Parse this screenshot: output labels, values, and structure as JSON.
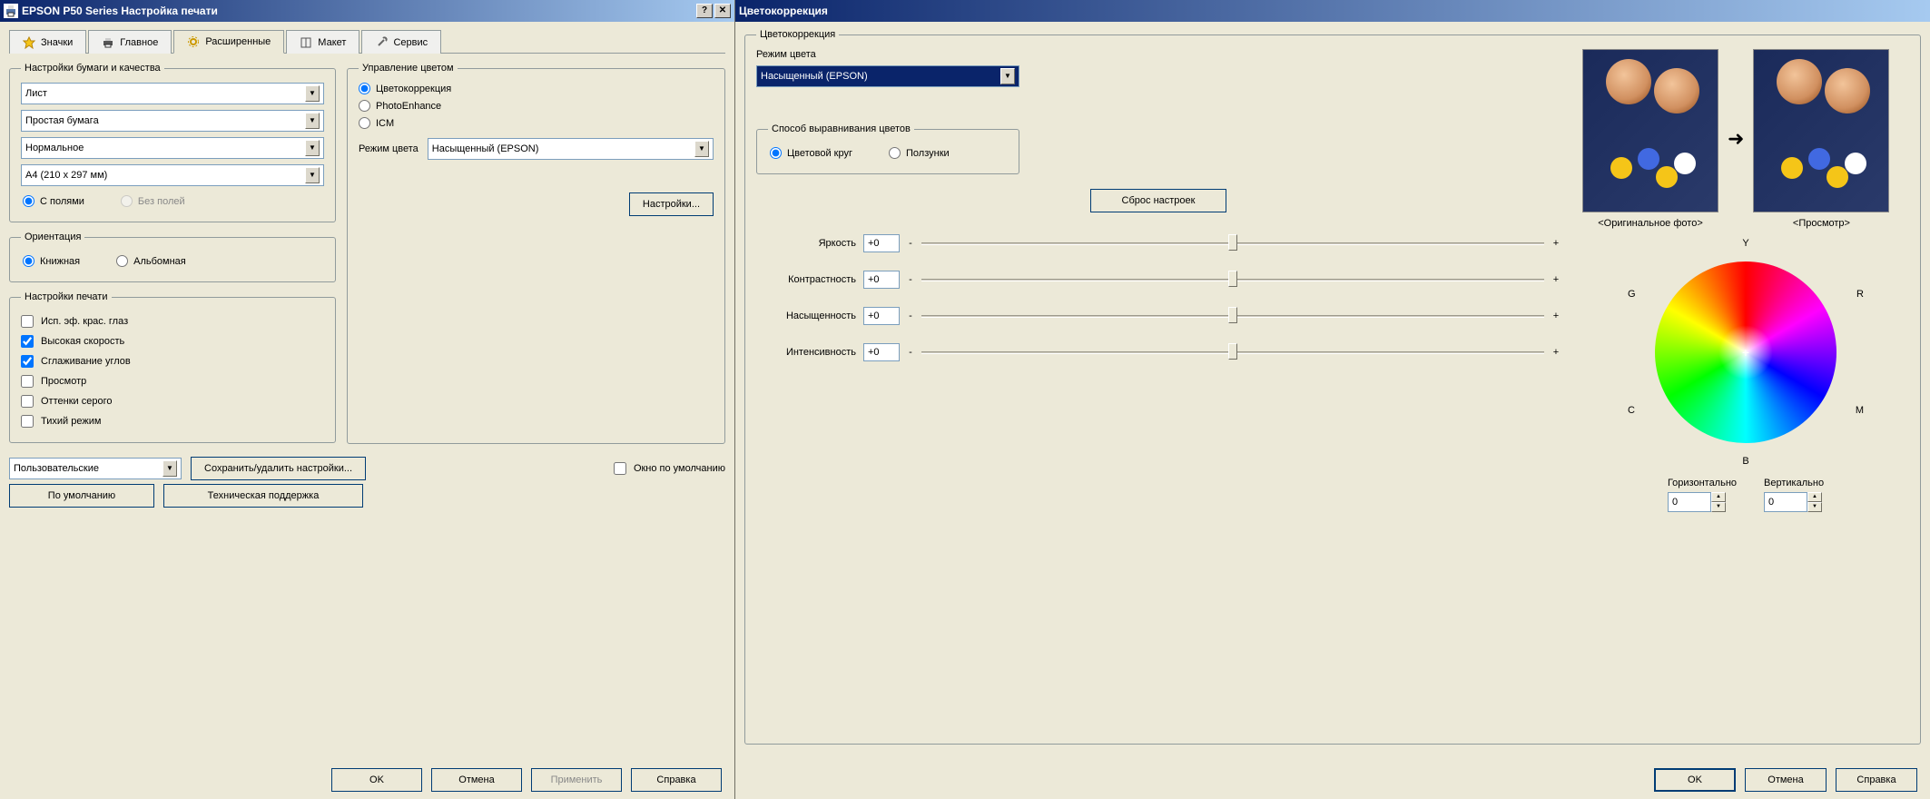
{
  "leftWindow": {
    "title": "EPSON P50 Series Настройка печати",
    "tabs": [
      {
        "label": "Значки",
        "icon": "star"
      },
      {
        "label": "Главное",
        "icon": "printer"
      },
      {
        "label": "Расширенные",
        "icon": "gear",
        "active": true
      },
      {
        "label": "Макет",
        "icon": "layout"
      },
      {
        "label": "Сервис",
        "icon": "wrench"
      }
    ],
    "paperGroup": {
      "legend": "Настройки бумаги и качества",
      "source": "Лист",
      "media": "Простая бумага",
      "quality": "Нормальное",
      "size": "A4 (210 x 297 мм)",
      "borderOptions": {
        "withBorders": "С полями",
        "borderless": "Без полей"
      }
    },
    "orientationGroup": {
      "legend": "Ориентация",
      "portrait": "Книжная",
      "landscape": "Альбомная"
    },
    "printOptionsGroup": {
      "legend": "Настройки печати",
      "items": [
        {
          "label": "Исп. эф. крас. глаз",
          "checked": false
        },
        {
          "label": "Высокая скорость",
          "checked": true
        },
        {
          "label": "Сглаживание углов",
          "checked": true
        },
        {
          "label": "Просмотр",
          "checked": false
        },
        {
          "label": "Оттенки серого",
          "checked": false
        },
        {
          "label": "Тихий режим",
          "checked": false
        }
      ]
    },
    "colorManagement": {
      "legend": "Управление цветом",
      "options": [
        "Цветокоррекция",
        "PhotoEnhance",
        "ICM"
      ],
      "selected": 0,
      "modeLabel": "Режим цвета",
      "modeValue": "Насыщенный (EPSON)",
      "settingsBtn": "Настройки..."
    },
    "presetCombo": "Пользовательские",
    "saveDeleteBtn": "Сохранить/удалить настройки...",
    "defaultWindowChk": "Окно по умолчанию",
    "defaultsBtn": "По умолчанию",
    "supportBtn": "Техническая поддержка",
    "okBtn": "OK",
    "cancelBtn": "Отмена",
    "applyBtn": "Применить",
    "helpBtn": "Справка"
  },
  "rightWindow": {
    "title": "Цветокоррекция",
    "groupLegend": "Цветокоррекция",
    "modeLabel": "Режим цвета",
    "modeValue": "Насыщенный (EPSON)",
    "alignGroup": {
      "legend": "Способ выравнивания цветов",
      "wheel": "Цветовой круг",
      "sliders": "Ползунки"
    },
    "resetBtn": "Сброс настроек",
    "adjustments": {
      "brightness": {
        "label": "Яркость",
        "value": "+0"
      },
      "contrast": {
        "label": "Контрастность",
        "value": "+0"
      },
      "saturation": {
        "label": "Насыщенность",
        "value": "+0"
      },
      "intensity": {
        "label": "Интенсивность",
        "value": "+0"
      }
    },
    "original": "<Оригинальное фото>",
    "preview": "<Просмотр>",
    "wheelLabels": {
      "Y": "Y",
      "R": "R",
      "M": "M",
      "B": "B",
      "C": "C",
      "G": "G"
    },
    "horizLabel": "Горизонтально",
    "vertLabel": "Вертикально",
    "horizValue": "0",
    "vertValue": "0",
    "okBtn": "OK",
    "cancelBtn": "Отмена",
    "helpBtn": "Справка"
  }
}
